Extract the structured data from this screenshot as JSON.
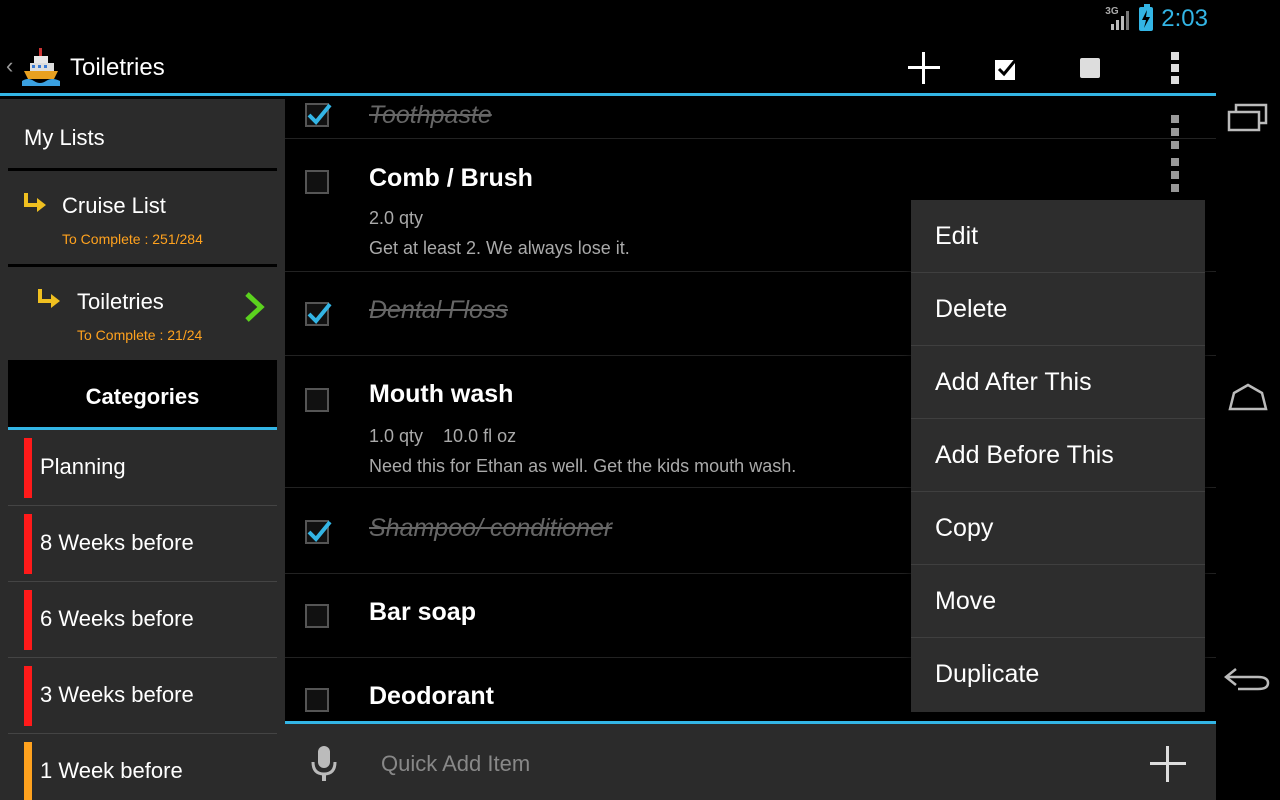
{
  "status": {
    "network": "3G",
    "time": "2:03"
  },
  "actionbar": {
    "title": "Toiletries"
  },
  "sidebar": {
    "my_lists_label": "My Lists",
    "lists": [
      {
        "name": "Cruise List",
        "sub": "To Complete : 251/284"
      },
      {
        "name": "Toiletries",
        "sub": "To Complete : 21/24"
      }
    ],
    "categories_label": "Categories",
    "categories": [
      {
        "label": "Planning",
        "color": "#ff1a1a"
      },
      {
        "label": "8 Weeks before",
        "color": "#ff1a1a"
      },
      {
        "label": "6 Weeks before",
        "color": "#ff1a1a"
      },
      {
        "label": "3 Weeks before",
        "color": "#ff1a1a"
      },
      {
        "label": "1 Week before",
        "color": "#ffa21e"
      }
    ]
  },
  "items": [
    {
      "title": "Toothpaste",
      "done": true
    },
    {
      "title": "Comb / Brush",
      "done": false,
      "qty": "2.0 qty",
      "size": "",
      "note": "Get at least 2. We always lose it."
    },
    {
      "title": "Dental Floss",
      "done": true
    },
    {
      "title": "Mouth wash",
      "done": false,
      "qty": "1.0 qty",
      "size": "10.0 fl oz",
      "note": "Need this for Ethan as well. Get the kids mouth wash."
    },
    {
      "title": "Shampoo/ conditioner",
      "done": true
    },
    {
      "title": "Bar soap",
      "done": false
    },
    {
      "title": "Deodorant",
      "done": false
    }
  ],
  "popup_menu": [
    "Edit",
    "Delete",
    "Add After This",
    "Add Before This",
    "Copy",
    "Move",
    "Duplicate"
  ],
  "quick_add": {
    "placeholder": "Quick Add Item"
  },
  "colors": {
    "accent": "#33b5e5",
    "orange": "#ffa21e",
    "green": "#5bd21e"
  }
}
